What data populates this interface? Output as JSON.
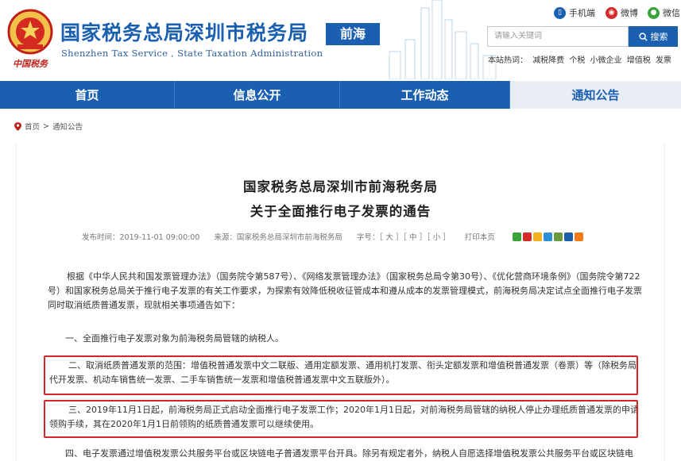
{
  "header": {
    "site_title": "国家税务总局深圳市税务局",
    "site_subtitle": "Shenzhen Tax Service , State Taxation Administration",
    "district": "前海",
    "emblem_text": "中国税务",
    "social": [
      {
        "label": "手机端",
        "icon": "mobile-icon",
        "color": "#1a5fb0"
      },
      {
        "label": "微博",
        "icon": "weibo-icon",
        "color": "#d52b2b"
      },
      {
        "label": "微信",
        "icon": "wechat-icon",
        "color": "#3aa33a"
      }
    ],
    "search": {
      "placeholder": "请输入关键词",
      "button": "搜索"
    },
    "hot_label": "本站热词：",
    "hot_words": [
      "减税降费",
      "个税",
      "小微企业",
      "增值税",
      "发票"
    ]
  },
  "nav": {
    "items": [
      {
        "label": "首页"
      },
      {
        "label": "信息公开"
      },
      {
        "label": "工作动态"
      },
      {
        "label": "通知公告",
        "active": true
      }
    ]
  },
  "breadcrumb": {
    "home": "首页",
    "sep": ">",
    "current": "通知公告"
  },
  "article": {
    "title_line1": "国家税务总局深圳市前海税务局",
    "title_line2": "关于全面推行电子发票的通告",
    "meta": {
      "date": "发布时间：2019-11-01 09:00:00",
      "source": "来源：国家税务总局深圳市前海税务局",
      "font_size": "字号：［ 大 ］［ 中 ］［ 小 ］",
      "print": "打印本页"
    },
    "paragraphs": {
      "intro": "根据《中华人民共和国发票管理办法》（国务院令第587号）、《网络发票管理办法》（国家税务总局令第30号）、《优化营商环境条例》（国务院令第722号）和国家税务总局关于推行电子发票的有关工作要求，为探索有效降低税收征管成本和遵从成本的发票管理模式，前海税务局决定试点全面推行电子发票同时取消纸质普通发票，现就相关事项通告如下：",
      "one": "一、全面推行电子发票对象为前海税务局管辖的纳税人。",
      "two": "二、取消纸质普通发票的范围：增值税普通发票中文二联版、通用定额发票、通用机打发票、衔头定额发票和增值税普通发票（卷票）等（除税务局代开发票、机动车销售统一发票、二手车销售统一发票和增值税普通发票中文五联版外）。",
      "three": "三、2019年11月1日起，前海税务局正式启动全面推行电子发票工作；2020年1月1日起，对前海税务局管辖的纳税人停止办理纸质普通发票的申请领购手续，其在2020年1月1日前领购的纸质普通发票可以继续使用。",
      "four": "四、电子发票通过增值税发票公共服务平台或区块链电子普通发票平台开具。除另有规定者外，纳税人自愿选择增值税发票公共服务平台或区块链电"
    }
  },
  "colors": {
    "brand": "#1a5fb0",
    "highlight": "#d4242a"
  }
}
